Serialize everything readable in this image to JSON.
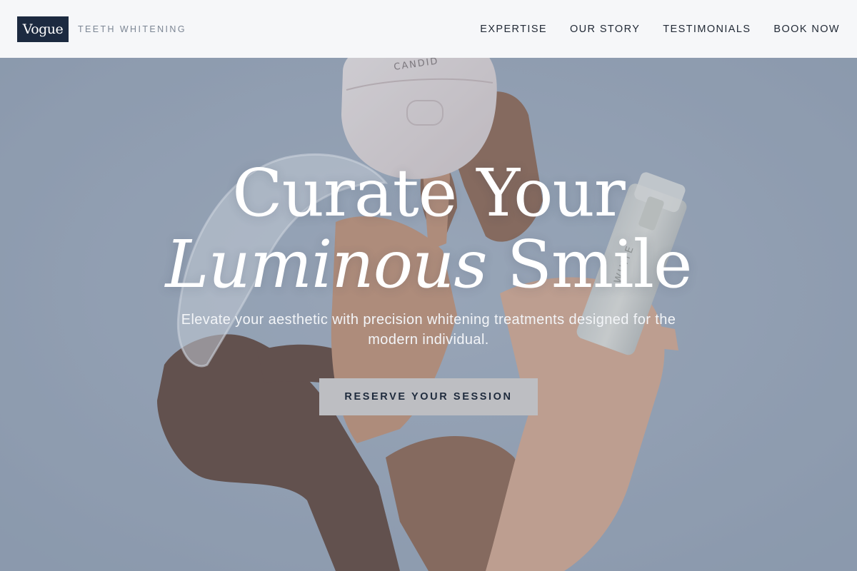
{
  "brand": {
    "logo_text": "Vogue",
    "tagline": "TEETH WHITENING"
  },
  "nav": {
    "items": [
      {
        "label": "EXPERTISE"
      },
      {
        "label": "OUR STORY"
      },
      {
        "label": "TESTIMONIALS"
      },
      {
        "label": "BOOK NOW"
      }
    ]
  },
  "hero": {
    "headline_line1": "Curate Your",
    "headline_italic": "Luminous",
    "headline_rest": " Smile",
    "subheadline": "Elevate your aesthetic with precision whitening treatments designed for the modern individual.",
    "cta_label": "RESERVE YOUR SESSION",
    "case_label": "CANDID",
    "bottle_label": "WHITE"
  },
  "colors": {
    "header_bg": "#f6f7f9",
    "logo_bg": "#1c2a40",
    "hero_bg": "#9ba9bb",
    "cta_bg": "#bdbec2",
    "cta_text": "#1f2b3d"
  }
}
